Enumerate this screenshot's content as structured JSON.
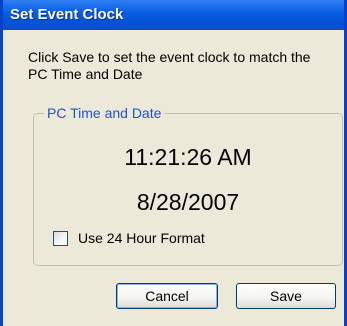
{
  "window": {
    "title": "Set Event Clock"
  },
  "description": "Click Save to set the event clock to match the PC Time and Date",
  "group": {
    "label": "PC Time and Date",
    "time": "11:21:26 AM",
    "date": "8/28/2007"
  },
  "checkbox": {
    "label": "Use 24 Hour Format",
    "checked": false
  },
  "buttons": {
    "cancel": "Cancel",
    "save": "Save"
  },
  "colors": {
    "title_bar": "#0a5fe5",
    "group_label": "#1f52d6",
    "dialog_bg": "#ece9d8"
  }
}
